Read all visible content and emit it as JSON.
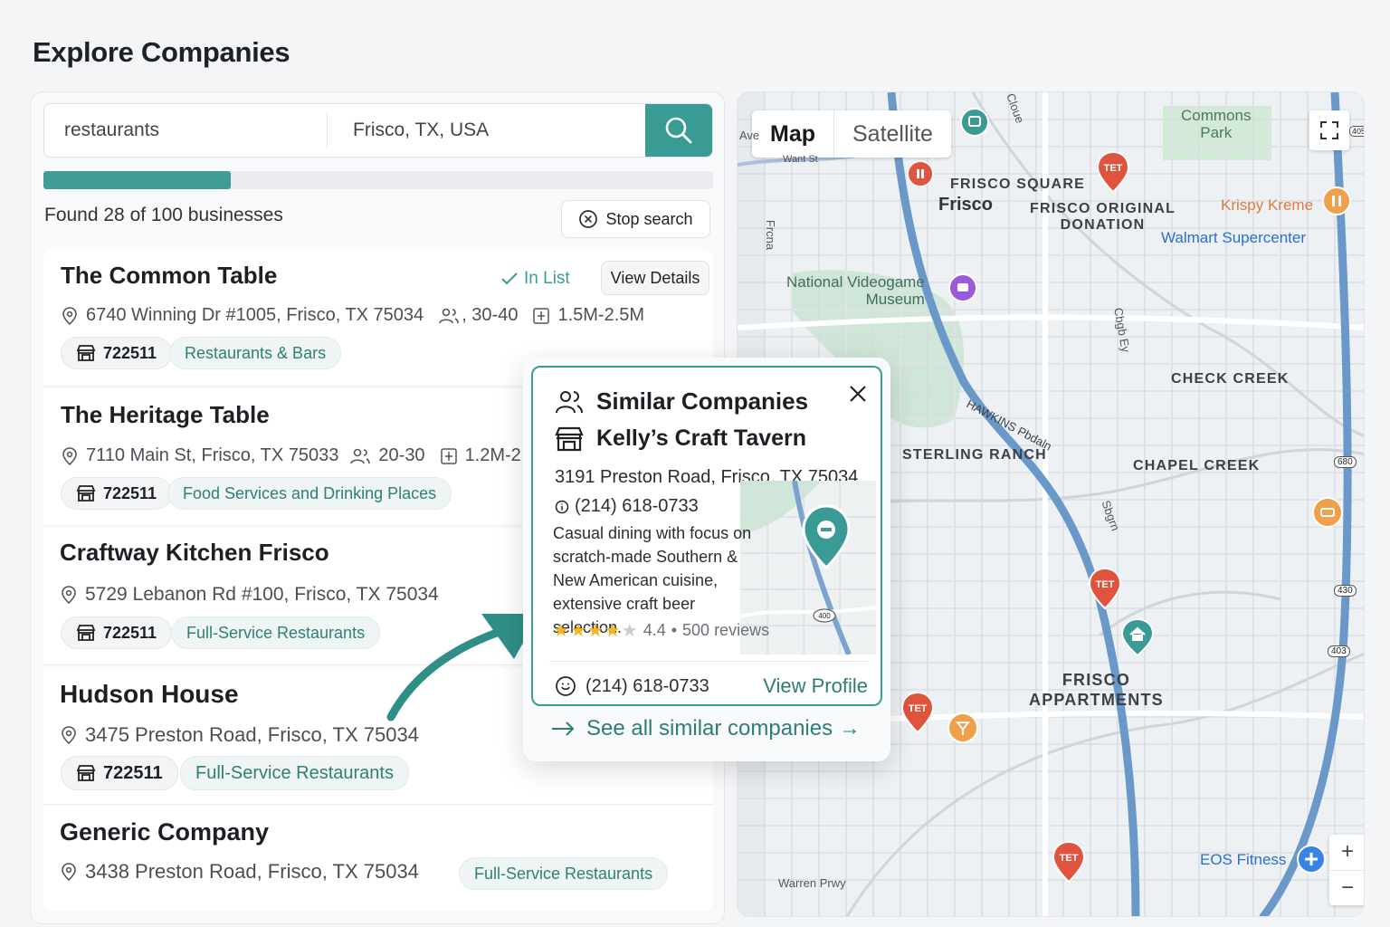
{
  "page": {
    "title": "Explore Companies"
  },
  "search": {
    "query": "restaurants",
    "location": "Frisco, TX, USA",
    "progress_percent": 28,
    "found_text": "Found 28 of 100 businesses",
    "stop_label": "Stop search"
  },
  "companies": [
    {
      "name": "The Common Table",
      "address": "6740 Winning Dr #1005, Frisco, TX 75034",
      "employees": ", 30-40",
      "revenue": "1.5M-2.5M",
      "code": "722511",
      "category": "Restaurants & Bars",
      "in_list": "In List",
      "view_details": "View Details"
    },
    {
      "name": "The Heritage Table",
      "address": "7110 Main St, Frisco, TX 75033",
      "employees": "20-30",
      "revenue": "1.2M-2",
      "code": "722511",
      "category": "Food Services and Drinking Places"
    },
    {
      "name": "Craftway Kitchen Frisco",
      "address": "5729 Lebanon Rd #100, Frisco, TX 75034",
      "code": "722511",
      "category": "Full-Service Restaurants"
    },
    {
      "name": "Hudson House",
      "address": "3475 Preston Road, Frisco, TX 75034",
      "code": "722511",
      "category": "Full-Service Restaurants"
    },
    {
      "name": "Generic Company",
      "address": "3438 Preston Road, Frisco, TX 75034",
      "category": "Full-Service Restaurants"
    }
  ],
  "map": {
    "toggle": {
      "map": "Map",
      "satellite": "Satellite"
    },
    "labels": {
      "commons_park": "Commons\nPark",
      "frisco_square": "FRISCO SQUARE",
      "frisco": "Frisco",
      "frisco_original": "FRISCO ORIGINAL\nDONATION",
      "krispy_kreme": "Krispy Kreme",
      "walmart": "Walmart Supercenter",
      "national_videogame": "National Videogame\nMuseum",
      "check_creek": "CHECK CREEK",
      "sterling_ranch": "STERLING RANCH",
      "chapel_creek": "CHAPEL CREEK",
      "frisco_appartments": "FRISCO\nAPPARTMENTS",
      "eos_fitness": "EOS Fitness",
      "warren_prwy": "Warren Prwy",
      "want_st": "Want St",
      "hawkins_pbdaln": "HAWKINS Pbdaln",
      "road_ave": "Ave",
      "road_3": "Frcna",
      "road_4": "Cloue",
      "road_5": "Cbgb Ey",
      "road_6": "Sbgrn",
      "hwy_1": "405",
      "hwy_2": "680",
      "hwy_3": "430",
      "hwy_4": "403",
      "hwy_5": "400"
    },
    "marker_text": "TET",
    "zoom_in": "+",
    "zoom_out": "−"
  },
  "popup": {
    "title": "Similar Companies",
    "company": "Kelly’s Craft Tavern",
    "address": "3191 Preston Road, Frisco, TX 75034",
    "phone": "(214) 618-0733",
    "description": "Casual dining with focus on scratch-made Southern & New American cuisine, extensive craft beer selection.",
    "rating": 4.4,
    "rating_text": "4.4",
    "reviews": "500 reviews",
    "footer_phone": "(214) 618-0733",
    "view_profile": "View Profile",
    "see_all": "See all similar companies →"
  },
  "colors": {
    "accent": "#3a9b94",
    "marker_red": "#e0533c",
    "marker_orange": "#f0a04b",
    "road_blue": "#5b8fc7"
  }
}
